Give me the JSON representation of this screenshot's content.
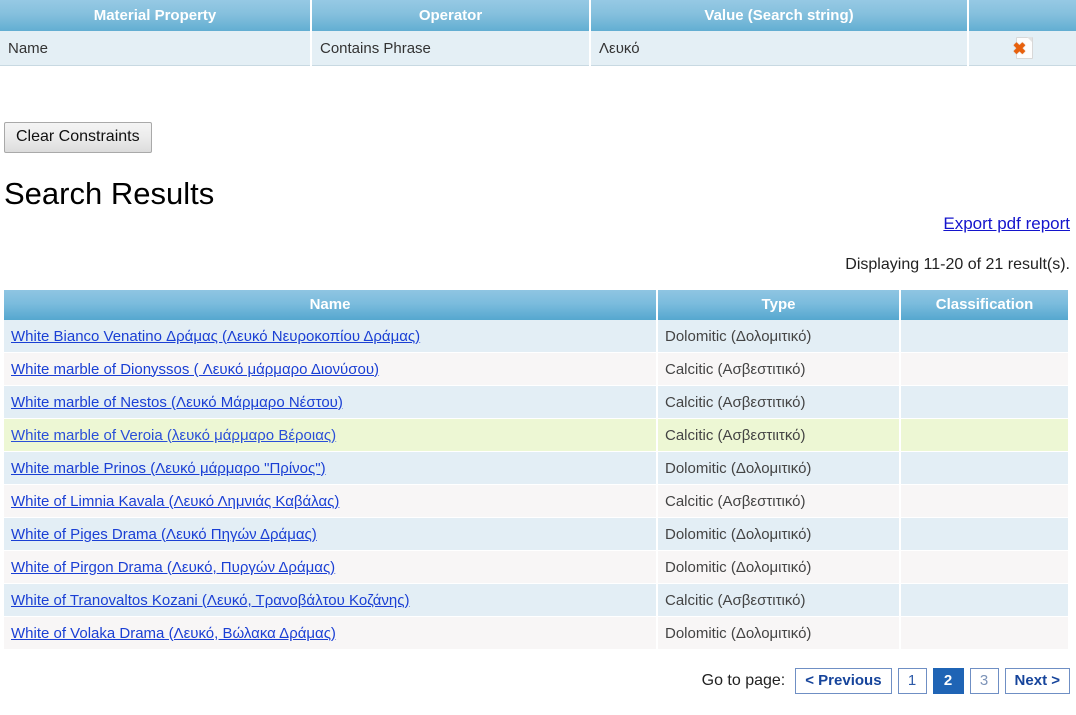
{
  "constraints": {
    "headers": [
      "Material Property",
      "Operator",
      "Value (Search string)",
      ""
    ],
    "rows": [
      {
        "property": "Name",
        "operator": "Contains Phrase",
        "value": "Λευκό",
        "delete_icon": "delete-page-icon",
        "delete_glyph": "✖"
      }
    ]
  },
  "toolbar": {
    "clear_constraints_label": "Clear Constraints"
  },
  "page": {
    "title": "Search Results",
    "export_label": "Export pdf report",
    "displaying": "Displaying 11-20 of 21 result(s)."
  },
  "results": {
    "headers": [
      "Name",
      "Type",
      "Classification"
    ],
    "rows": [
      {
        "name": "White Bianco Venatino Δράμας (Λευκό Νευροκοπίου Δράμας)",
        "type": "Dolomitic (Δολομιτικό)",
        "classification": ""
      },
      {
        "name": "White marble of Dionyssos ( Λευκό μάρμαρο Διονύσου)",
        "type": "Calcitic (Ασβεστιτικό)",
        "classification": ""
      },
      {
        "name": "White marble of Nestos (Λευκό Μάρμαρο Νέστου)",
        "type": "Calcitic (Ασβεστιτικό)",
        "classification": ""
      },
      {
        "name": "White marble of Veroia (λευκό μάρμαρο Βέροιας)",
        "type": "Calcitic (Ασβεστιιτκό)",
        "classification": ""
      },
      {
        "name": "White marble Prinos (Λευκό μάρμαρο \"Πρίνος\")",
        "type": "Dolomitic (Δολομιτικό)",
        "classification": ""
      },
      {
        "name": "White of Limnia Kavala (Λευκό Λημνιάς Καβάλας)",
        "type": "Calcitic (Ασβεστιτικό)",
        "classification": ""
      },
      {
        "name": "White of Piges Drama (Λευκό Πηγών Δράμας)",
        "type": "Dolomitic (Δολομιτικό)",
        "classification": ""
      },
      {
        "name": "White of Pirgon Drama (Λευκό, Πυργών Δράμας)",
        "type": "Dolomitic (Δολομιτικό)",
        "classification": ""
      },
      {
        "name": "White of Tranovaltos Kozani (Λευκό, Τρανοβάλτου Κοζάνης)",
        "type": "Calcitic (Ασβεστιτικό)",
        "classification": ""
      },
      {
        "name": "White of Volaka Drama (Λευκό, Βώλακα Δράμας)",
        "type": "Dolomitic (Δολομιτικό)",
        "classification": ""
      }
    ],
    "highlighted_row_index": 3
  },
  "pagination": {
    "label": "Go to page:",
    "previous_label": "< Previous",
    "next_label": "Next >",
    "pages": [
      "1",
      "2",
      "3"
    ],
    "current_page": "2"
  },
  "colors": {
    "header_blue_top": "#8fc5e2",
    "header_blue_bottom": "#55a7cf",
    "row_odd": "#e3eef5",
    "row_even": "#f8f6f6",
    "row_highlight": "#edf7d4",
    "link_blue": "#1a3fd4",
    "pager_active_bg": "#1f64b5",
    "delete_icon_orange": "#e8600c"
  }
}
